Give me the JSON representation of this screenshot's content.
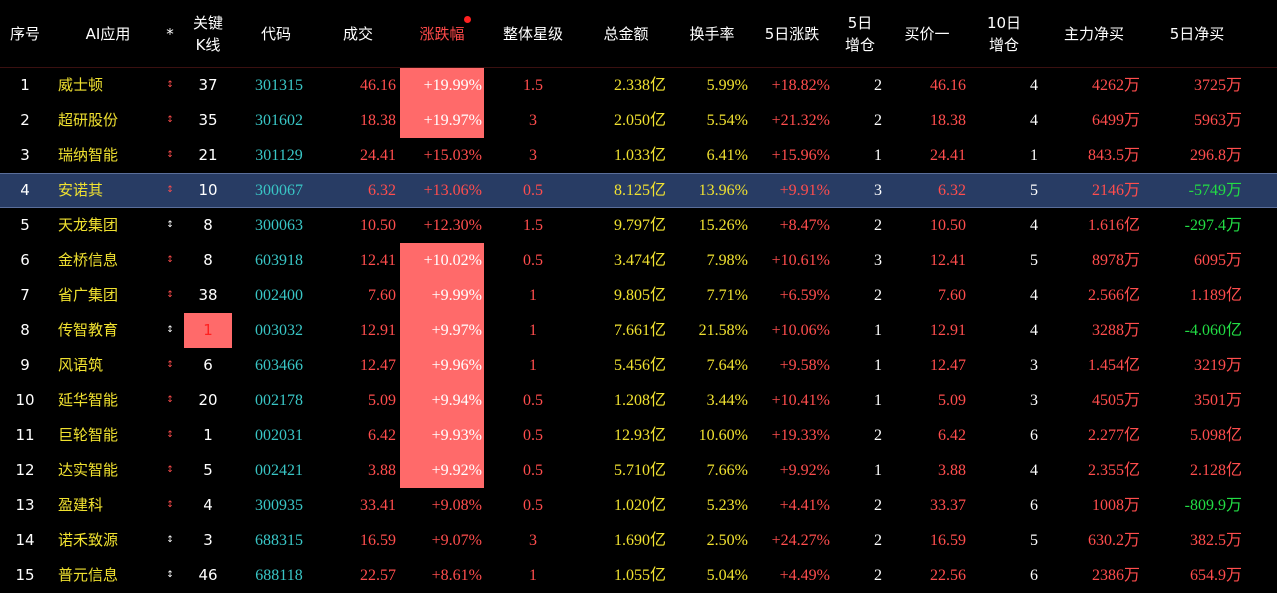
{
  "colors": {
    "background": "#000000",
    "header_text": "#ffffff",
    "sorted_header": "#ff4a4a",
    "name": "#f0e130",
    "code": "#39c6c6",
    "up": "#ff4d4d",
    "down": "#22dd44",
    "neutral": "#ffffff",
    "yellow_value": "#f0e130",
    "highlight_bg": "#ff6a6a",
    "selected_row_bg": "#283c64"
  },
  "headers": {
    "seq": "序号",
    "ai": "AI应用",
    "star": "*",
    "kline_1": "关键",
    "kline_2": "K线",
    "code": "代码",
    "price": "成交",
    "change": "涨跌幅",
    "rating": "整体星级",
    "amount": "总金额",
    "turnover": "换手率",
    "chg5": "5日涨跌",
    "add5_1": "5日",
    "add5_2": "增仓",
    "bid": "买价一",
    "add10_1": "10日",
    "add10_2": "增仓",
    "mainnet": "主力净买",
    "net5": "5日净买"
  },
  "rows": [
    {
      "seq": "1",
      "name": "威士顿",
      "star": "↕",
      "kline": "37",
      "code": "301315",
      "price": "46.16",
      "change": "+19.99%",
      "rating": "1.5",
      "amount": "2.338亿",
      "turnover": "5.99%",
      "chg5": "+18.82%",
      "add5": "2",
      "bid": "46.16",
      "add10": "4",
      "mainnet": "4262万",
      "net5": "3725万"
    },
    {
      "seq": "2",
      "name": "超研股份",
      "star": "↕",
      "kline": "35",
      "code": "301602",
      "price": "18.38",
      "change": "+19.97%",
      "rating": "3",
      "amount": "2.050亿",
      "turnover": "5.54%",
      "chg5": "+21.32%",
      "add5": "2",
      "bid": "18.38",
      "add10": "4",
      "mainnet": "6499万",
      "net5": "5963万"
    },
    {
      "seq": "3",
      "name": "瑞纳智能",
      "star": "↕",
      "kline": "21",
      "code": "301129",
      "price": "24.41",
      "change": "+15.03%",
      "rating": "3",
      "amount": "1.033亿",
      "turnover": "6.41%",
      "chg5": "+15.96%",
      "add5": "1",
      "bid": "24.41",
      "add10": "1",
      "mainnet": "843.5万",
      "net5": "296.8万"
    },
    {
      "seq": "4",
      "name": "安诺其",
      "star": "↕",
      "kline": "10",
      "code": "300067",
      "price": "6.32",
      "change": "+13.06%",
      "rating": "0.5",
      "amount": "8.125亿",
      "turnover": "13.96%",
      "chg5": "+9.91%",
      "add5": "3",
      "bid": "6.32",
      "add10": "5",
      "mainnet": "2146万",
      "net5": "-5749万"
    },
    {
      "seq": "5",
      "name": "天龙集团",
      "star": "↕",
      "kline": "8",
      "code": "300063",
      "price": "10.50",
      "change": "+12.30%",
      "rating": "1.5",
      "amount": "9.797亿",
      "turnover": "15.26%",
      "chg5": "+8.47%",
      "add5": "2",
      "bid": "10.50",
      "add10": "4",
      "mainnet": "1.616亿",
      "net5": "-297.4万"
    },
    {
      "seq": "6",
      "name": "金桥信息",
      "star": "↕",
      "kline": "8",
      "code": "603918",
      "price": "12.41",
      "change": "+10.02%",
      "rating": "0.5",
      "amount": "3.474亿",
      "turnover": "7.98%",
      "chg5": "+10.61%",
      "add5": "3",
      "bid": "12.41",
      "add10": "5",
      "mainnet": "8978万",
      "net5": "6095万"
    },
    {
      "seq": "7",
      "name": "省广集团",
      "star": "↕",
      "kline": "38",
      "code": "002400",
      "price": "7.60",
      "change": "+9.99%",
      "rating": "1",
      "amount": "9.805亿",
      "turnover": "7.71%",
      "chg5": "+6.59%",
      "add5": "2",
      "bid": "7.60",
      "add10": "4",
      "mainnet": "2.566亿",
      "net5": "1.189亿"
    },
    {
      "seq": "8",
      "name": "传智教育",
      "star": "↕",
      "kline": "1",
      "code": "003032",
      "price": "12.91",
      "change": "+9.97%",
      "rating": "1",
      "amount": "7.661亿",
      "turnover": "21.58%",
      "chg5": "+10.06%",
      "add5": "1",
      "bid": "12.91",
      "add10": "4",
      "mainnet": "3288万",
      "net5": "-4.060亿"
    },
    {
      "seq": "9",
      "name": "风语筑",
      "star": "↕",
      "kline": "6",
      "code": "603466",
      "price": "12.47",
      "change": "+9.96%",
      "rating": "1",
      "amount": "5.456亿",
      "turnover": "7.64%",
      "chg5": "+9.58%",
      "add5": "1",
      "bid": "12.47",
      "add10": "3",
      "mainnet": "1.454亿",
      "net5": "3219万"
    },
    {
      "seq": "10",
      "name": "延华智能",
      "star": "↕",
      "kline": "20",
      "code": "002178",
      "price": "5.09",
      "change": "+9.94%",
      "rating": "0.5",
      "amount": "1.208亿",
      "turnover": "3.44%",
      "chg5": "+10.41%",
      "add5": "1",
      "bid": "5.09",
      "add10": "3",
      "mainnet": "4505万",
      "net5": "3501万"
    },
    {
      "seq": "11",
      "name": "巨轮智能",
      "star": "↕",
      "kline": "1",
      "code": "002031",
      "price": "6.42",
      "change": "+9.93%",
      "rating": "0.5",
      "amount": "12.93亿",
      "turnover": "10.60%",
      "chg5": "+19.33%",
      "add5": "2",
      "bid": "6.42",
      "add10": "6",
      "mainnet": "2.277亿",
      "net5": "5.098亿"
    },
    {
      "seq": "12",
      "name": "达实智能",
      "star": "↕",
      "kline": "5",
      "code": "002421",
      "price": "3.88",
      "change": "+9.92%",
      "rating": "0.5",
      "amount": "5.710亿",
      "turnover": "7.66%",
      "chg5": "+9.92%",
      "add5": "1",
      "bid": "3.88",
      "add10": "4",
      "mainnet": "2.355亿",
      "net5": "2.128亿"
    },
    {
      "seq": "13",
      "name": "盈建科",
      "star": "↕",
      "kline": "4",
      "code": "300935",
      "price": "33.41",
      "change": "+9.08%",
      "rating": "0.5",
      "amount": "1.020亿",
      "turnover": "5.23%",
      "chg5": "+4.41%",
      "add5": "2",
      "bid": "33.37",
      "add10": "6",
      "mainnet": "1008万",
      "net5": "-809.9万"
    },
    {
      "seq": "14",
      "name": "诺禾致源",
      "star": "↕",
      "kline": "3",
      "code": "688315",
      "price": "16.59",
      "change": "+9.07%",
      "rating": "3",
      "amount": "1.690亿",
      "turnover": "2.50%",
      "chg5": "+24.27%",
      "add5": "2",
      "bid": "16.59",
      "add10": "5",
      "mainnet": "630.2万",
      "net5": "382.5万"
    },
    {
      "seq": "15",
      "name": "普元信息",
      "star": "↕",
      "kline": "46",
      "code": "688118",
      "price": "22.57",
      "change": "+8.61%",
      "rating": "1",
      "amount": "1.055亿",
      "turnover": "5.04%",
      "chg5": "+4.49%",
      "add5": "2",
      "bid": "22.56",
      "add10": "6",
      "mainnet": "2386万",
      "net5": "654.9万"
    }
  ]
}
